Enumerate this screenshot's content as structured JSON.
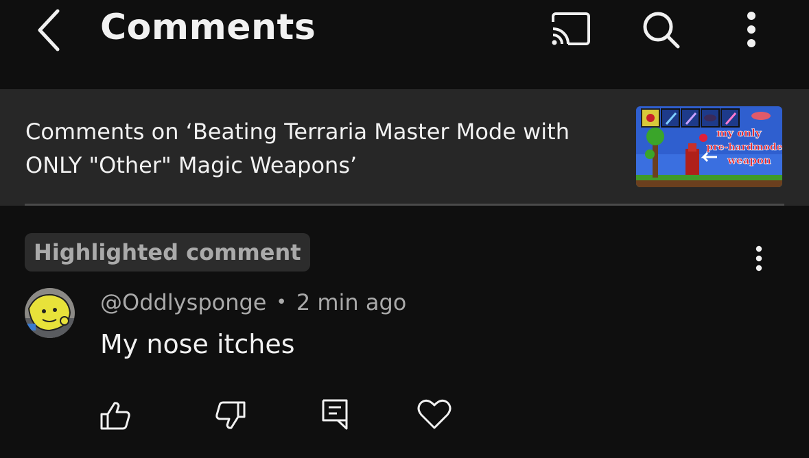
{
  "header": {
    "title": "Comments",
    "back_icon": "chevron-left-icon",
    "cast_icon": "cast-icon",
    "search_icon": "search-icon",
    "more_icon": "more-vert-icon"
  },
  "video": {
    "title": "Comments on ‘Beating Terraria Master Mode with ONLY \"Other\" Magic Weapons’",
    "thumbnail_text": [
      "my only",
      "pre-hardmode",
      "weapon"
    ]
  },
  "comment": {
    "highlight_label": "Highlighted comment",
    "author": "@Oddlysponge",
    "separator": "•",
    "time": "2 min ago",
    "text": "My nose itches",
    "actions": [
      "like-icon",
      "dislike-icon",
      "reply-icon",
      "heart-icon"
    ]
  },
  "colors": {
    "background": "#0f0f0f",
    "video_bar": "#272727",
    "chip": "#2c2c2c",
    "secondary_text": "#aaaaaa"
  }
}
